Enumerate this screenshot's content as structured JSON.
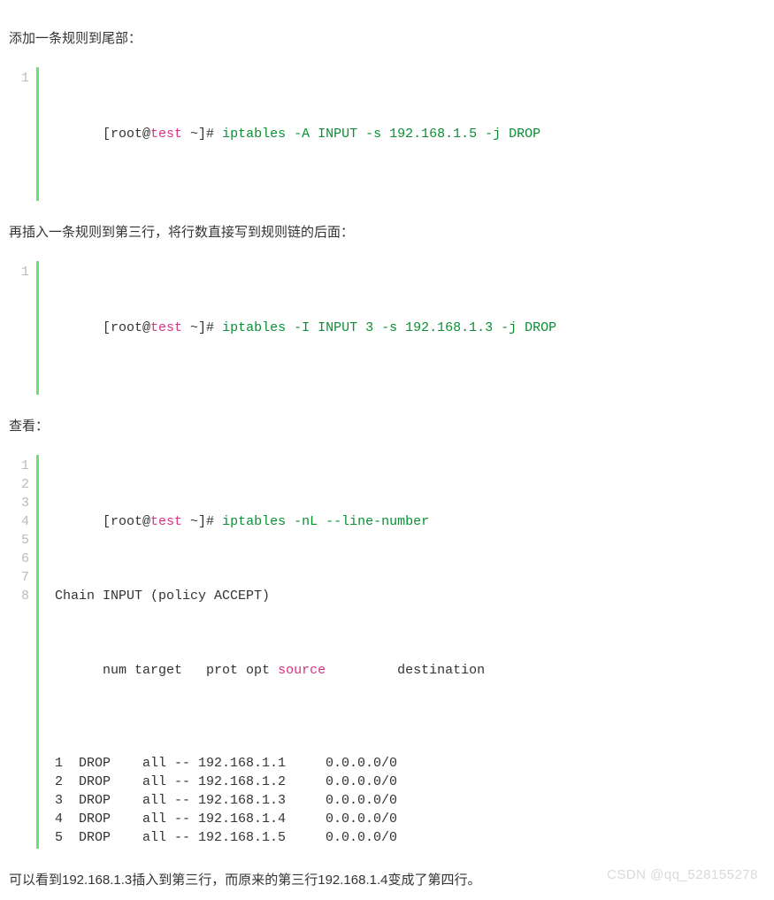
{
  "paragraphs": {
    "p1": "添加一条规则到尾部：",
    "p2": "再插入一条规则到第三行，将行数直接写到规则链的后面：",
    "p3": "查看：",
    "p4": "可以看到192.168.1.3插入到第三行，而原来的第三行192.168.1.4变成了第四行。"
  },
  "code1": {
    "line_numbers": [
      "1"
    ],
    "prompt": {
      "lb": "[root@",
      "host": "test",
      "tail": " ~]# "
    },
    "cmd": "iptables -A INPUT -s 192.168.1.5 -j DROP"
  },
  "code2": {
    "line_numbers": [
      "1"
    ],
    "prompt": {
      "lb": "[root@",
      "host": "test",
      "tail": " ~]# "
    },
    "cmd": "iptables -I INPUT 3 -s 192.168.1.3 -j DROP"
  },
  "code3": {
    "line_numbers": [
      "1",
      "2",
      "3",
      "4",
      "5",
      "6",
      "7",
      "8"
    ],
    "lines": {
      "l1": {
        "prompt": {
          "lb": "[root@",
          "host": "test",
          "tail": " ~]# "
        },
        "cmd": "iptables -nL --line-number"
      },
      "l2": "Chain INPUT (policy ACCEPT)",
      "l3": {
        "before_source": "num target   prot opt ",
        "source_word": "source",
        "after_source": "         destination"
      },
      "rows": [
        {
          "num": "1",
          "target": "DROP",
          "prot": "all",
          "opt": "--",
          "source": "192.168.1.1",
          "dest": "0.0.0.0/0"
        },
        {
          "num": "2",
          "target": "DROP",
          "prot": "all",
          "opt": "--",
          "source": "192.168.1.2",
          "dest": "0.0.0.0/0"
        },
        {
          "num": "3",
          "target": "DROP",
          "prot": "all",
          "opt": "--",
          "source": "192.168.1.3",
          "dest": "0.0.0.0/0"
        },
        {
          "num": "4",
          "target": "DROP",
          "prot": "all",
          "opt": "--",
          "source": "192.168.1.4",
          "dest": "0.0.0.0/0"
        },
        {
          "num": "5",
          "target": "DROP",
          "prot": "all",
          "opt": "--",
          "source": "192.168.1.5",
          "dest": "0.0.0.0/0"
        }
      ]
    }
  },
  "watermark": "CSDN @qq_528155278"
}
